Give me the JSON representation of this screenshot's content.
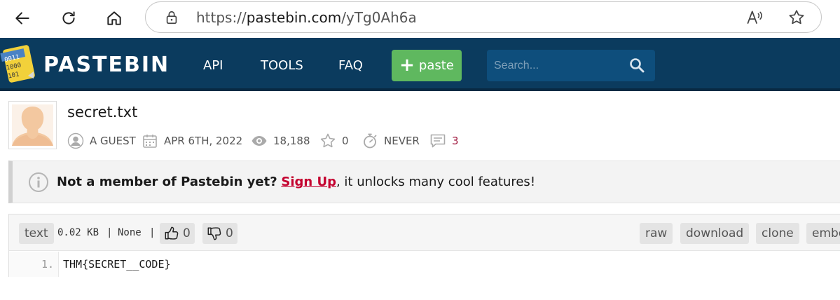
{
  "browser": {
    "url_prefix": "https://",
    "url_host": "pastebin.com",
    "url_path": "/yTg0Ah6a"
  },
  "header": {
    "logo_text": "PASTEBIN",
    "menu": [
      "API",
      "TOOLS",
      "FAQ"
    ],
    "paste_label": "paste",
    "search_placeholder": "Search..."
  },
  "paste": {
    "title": "secret.txt",
    "author": "A GUEST",
    "date": "APR 6TH, 2022",
    "views": "18,188",
    "stars": "0",
    "expiry": "NEVER",
    "comments": "3"
  },
  "notice": {
    "lead": "Not a member of Pastebin yet?",
    "signup": "Sign Up",
    "tail": ", it unlocks many cool features!"
  },
  "code": {
    "syntax": "text",
    "size": "0.02 KB",
    "separator1": "|",
    "category": "None",
    "separator2": "|",
    "likes": "0",
    "dislikes": "0",
    "actions": [
      "raw",
      "download",
      "clone",
      "embed"
    ],
    "lines": [
      {
        "num": "1.",
        "text": "THM{SECRET__CODE}"
      }
    ]
  },
  "colors": {
    "header_bg": "#0b3b5e",
    "paste_button": "#5fb85f",
    "signup_link": "#c4002f"
  }
}
